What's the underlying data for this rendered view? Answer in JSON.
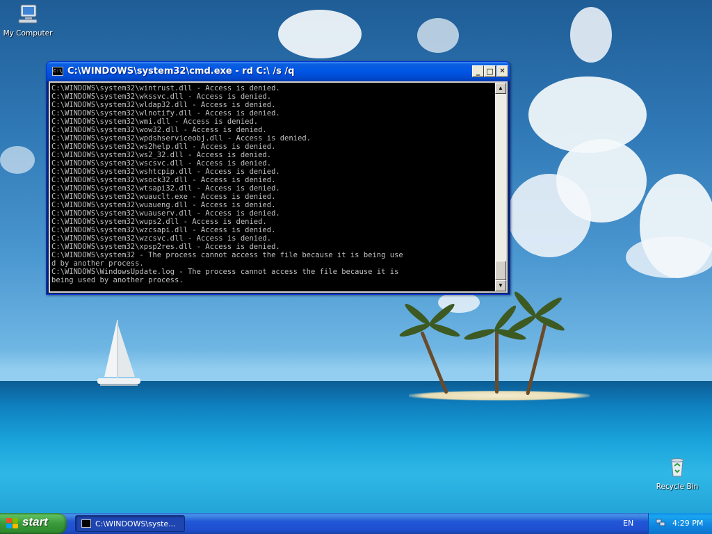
{
  "desktop": {
    "icons": [
      {
        "label": "My Computer",
        "icon": "my-computer-icon"
      },
      {
        "label": "Recycle Bin",
        "icon": "recycle-bin-icon"
      }
    ]
  },
  "cmd_window": {
    "title": "C:\\WINDOWS\\system32\\cmd.exe - rd C:\\ /s /q",
    "app_icon": "C:\\",
    "minimize": "_",
    "maximize": "□",
    "close": "✕",
    "console_lines": [
      "C:\\WINDOWS\\system32\\wintrust.dll - Access is denied.",
      "C:\\WINDOWS\\system32\\wkssvc.dll - Access is denied.",
      "C:\\WINDOWS\\system32\\wldap32.dll - Access is denied.",
      "C:\\WINDOWS\\system32\\wlnotify.dll - Access is denied.",
      "C:\\WINDOWS\\system32\\wmi.dll - Access is denied.",
      "C:\\WINDOWS\\system32\\wow32.dll - Access is denied.",
      "C:\\WINDOWS\\system32\\wpdshserviceobj.dll - Access is denied.",
      "C:\\WINDOWS\\system32\\ws2help.dll - Access is denied.",
      "C:\\WINDOWS\\system32\\ws2_32.dll - Access is denied.",
      "C:\\WINDOWS\\system32\\wscsvc.dll - Access is denied.",
      "C:\\WINDOWS\\system32\\wshtcpip.dll - Access is denied.",
      "C:\\WINDOWS\\system32\\wsock32.dll - Access is denied.",
      "C:\\WINDOWS\\system32\\wtsapi32.dll - Access is denied.",
      "C:\\WINDOWS\\system32\\wuauclt.exe - Access is denied.",
      "C:\\WINDOWS\\system32\\wuaueng.dll - Access is denied.",
      "C:\\WINDOWS\\system32\\wuauserv.dll - Access is denied.",
      "C:\\WINDOWS\\system32\\wups2.dll - Access is denied.",
      "C:\\WINDOWS\\system32\\wzcsapi.dll - Access is denied.",
      "C:\\WINDOWS\\system32\\wzcsvc.dll - Access is denied.",
      "C:\\WINDOWS\\system32\\xpsp2res.dll - Access is denied.",
      "C:\\WINDOWS\\system32 - The process cannot access the file because it is being use",
      "d by another process.",
      "C:\\WINDOWS\\WindowsUpdate.log - The process cannot access the file because it is",
      "being used by another process."
    ],
    "scroll_up": "▲",
    "scroll_down": "▼"
  },
  "taskbar": {
    "start_label": "start",
    "task_button_label": "C:\\WINDOWS\\syste...",
    "language": "EN",
    "clock": "4:29 PM"
  }
}
